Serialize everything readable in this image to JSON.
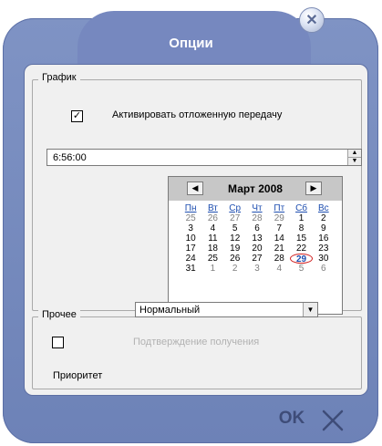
{
  "window": {
    "title": "Опции"
  },
  "schedule": {
    "legend": "График",
    "activate_label": "Активировать отложенную передачу",
    "activate_checked": true,
    "time_value": "6:56:00",
    "calendar": {
      "month_label": "Март 2008",
      "prev": "◀",
      "next": "▶",
      "weekdays": [
        "Пн",
        "Вт",
        "Ср",
        "Чт",
        "Пт",
        "Сб",
        "Вс"
      ],
      "weeks": [
        [
          "25",
          "26",
          "27",
          "28",
          "29",
          "1",
          "2"
        ],
        [
          "3",
          "4",
          "5",
          "6",
          "7",
          "8",
          "9"
        ],
        [
          "10",
          "11",
          "12",
          "13",
          "14",
          "15",
          "16"
        ],
        [
          "17",
          "18",
          "19",
          "20",
          "21",
          "22",
          "23"
        ],
        [
          "24",
          "25",
          "26",
          "27",
          "28",
          "29",
          "30"
        ],
        [
          "31",
          "1",
          "2",
          "3",
          "4",
          "5",
          "6"
        ]
      ],
      "selected": "29"
    }
  },
  "other": {
    "legend": "Прочее",
    "confirm_label": "Подтверждение получения",
    "confirm_checked": false,
    "priority_label": "Приоритет",
    "priority_value": "Нормальный"
  },
  "buttons": {
    "ok": "OK",
    "close_glyph": "✕"
  }
}
